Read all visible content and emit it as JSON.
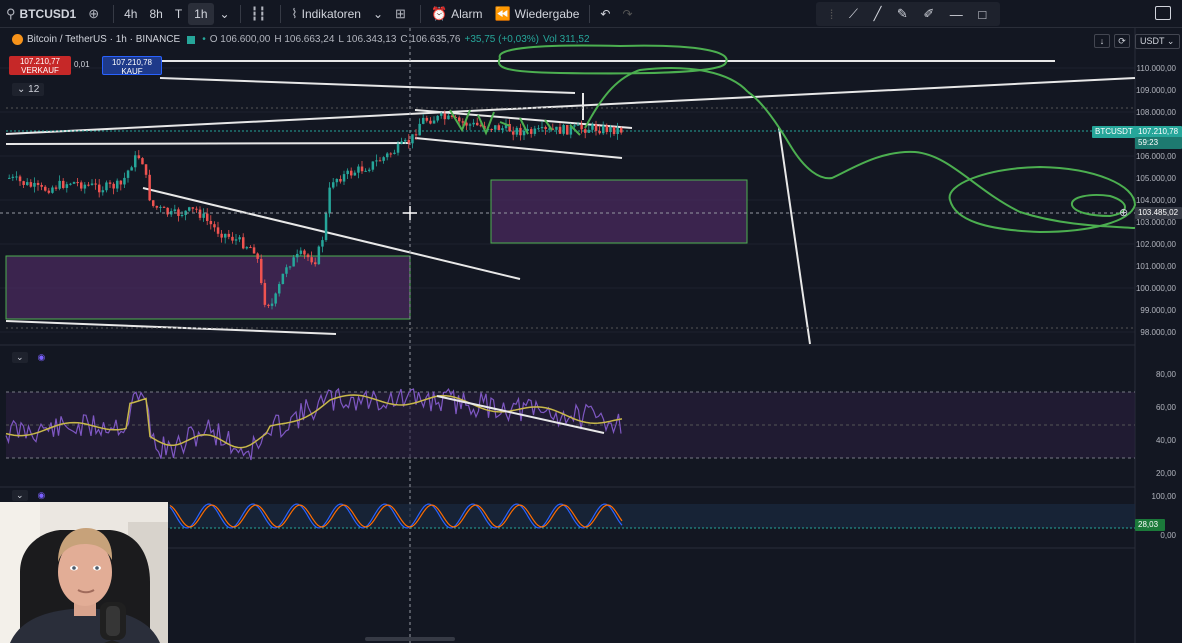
{
  "toolbar": {
    "symbol": "BTCUSD1",
    "intervals": [
      "4h",
      "8h",
      "T",
      "1h"
    ],
    "active_interval": "1h",
    "indicators_label": "Indikatoren",
    "alarm_label": "Alarm",
    "replay_label": "Wiedergabe"
  },
  "legend": {
    "title": "Bitcoin / TetherUS · 1h · BINANCE",
    "open": "O 106.600,00",
    "high": "H 106.663,24",
    "low": "L 106.343,13",
    "close": "C 106.635,76",
    "change": "+35,75 (+0,03%)",
    "volume": "Vol 311,52"
  },
  "trade": {
    "sell_price": "107.210,77",
    "sell_label": "VERKAUF",
    "spread": "0,01",
    "buy_price": "107.210,78",
    "buy_label": "KAUF"
  },
  "collapsed_count": "12",
  "currency": "USDT",
  "price_axis": {
    "labels": [
      "110.000,00",
      "109.000,00",
      "108.000,00",
      "106.000,00",
      "105.000,00",
      "104.000,00",
      "103.000,00",
      "102.000,00",
      "101.000,00",
      "100.000,00",
      "99.000,00",
      "98.000,00"
    ],
    "symbol_tag": "BTCUSDT",
    "current_price": "107.210,78",
    "countdown": "59:23",
    "crosshair_price": "103.485,02"
  },
  "rsi_axis": [
    "80,00",
    "60,00",
    "40,00",
    "20,00"
  ],
  "stoch_axis": [
    "100,00",
    "28,03",
    "0,00"
  ],
  "colors": {
    "background": "#131722",
    "up": "#26a69a",
    "down": "#ef5350",
    "drawing_green": "#4caf50",
    "zone": "#4a2a5e"
  }
}
